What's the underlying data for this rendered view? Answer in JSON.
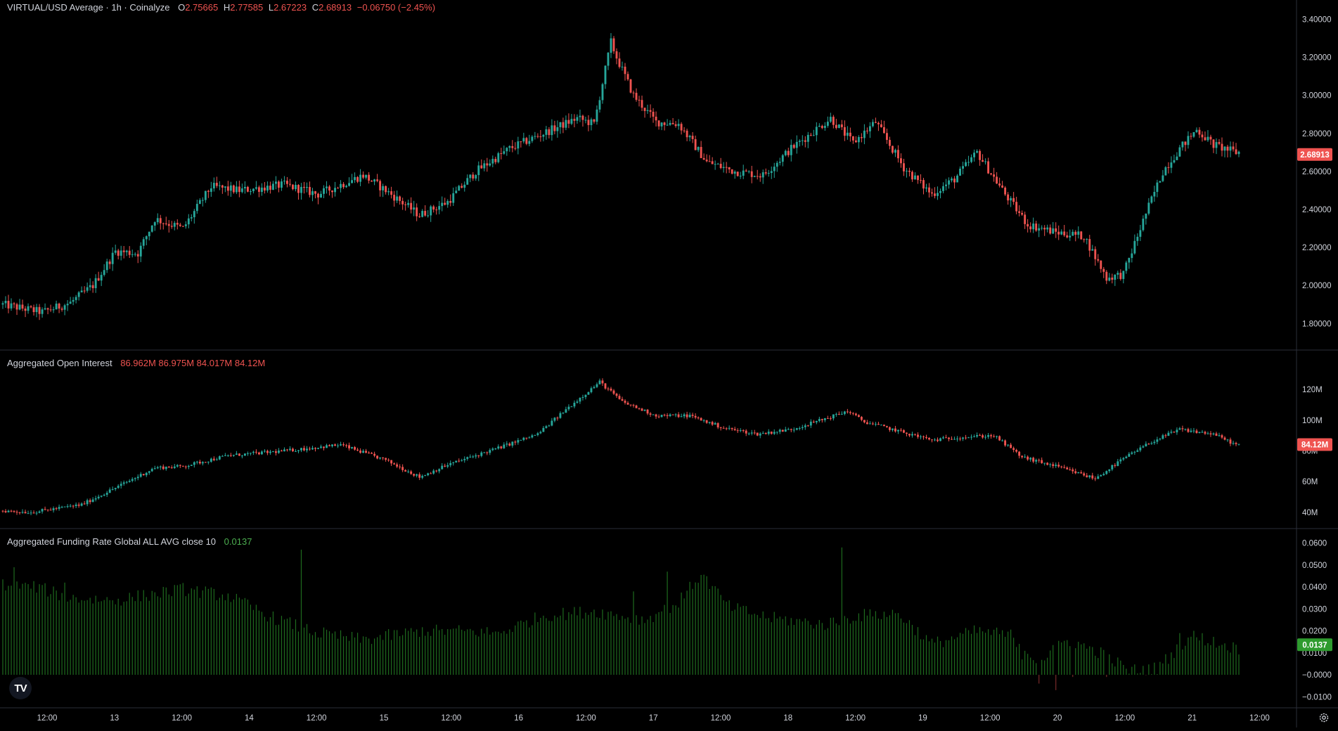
{
  "colors": {
    "up": "#26a69a",
    "down": "#ef5350",
    "funding": "#1e6b1e",
    "funding_bright": "#4caf50",
    "grid": "#2a2e39",
    "text": "#d1d4dc"
  },
  "main_legend": {
    "title": "VIRTUAL/USD Average · 1h · Coinalyze",
    "o_label": "O",
    "o": "2.75665",
    "h_label": "H",
    "h": "2.77585",
    "l_label": "L",
    "l": "2.67223",
    "c_label": "C",
    "c": "2.68913",
    "change": "−0.06750 (−2.45%)"
  },
  "oi_legend": {
    "title": "Aggregated Open Interest",
    "values": "86.962M  86.975M  84.017M  84.12M"
  },
  "fr_legend": {
    "title": "Aggregated Funding Rate Global ALL AVG close 10",
    "value": "0.0137"
  },
  "logo_text": "TV",
  "chart_data": [
    {
      "type": "candlestick",
      "name": "price",
      "ylim": [
        1.72,
        3.42
      ],
      "y_ticks": [
        "3.40000",
        "3.20000",
        "3.00000",
        "2.80000",
        "2.60000",
        "2.40000",
        "2.20000",
        "2.00000",
        "1.80000"
      ],
      "last_value": "2.68913",
      "x_ticks": [
        "12:00",
        "13",
        "12:00",
        "14",
        "12:00",
        "15",
        "12:00",
        "16",
        "12:00",
        "17",
        "12:00",
        "18",
        "12:00",
        "19",
        "12:00",
        "20",
        "12:00",
        "21",
        "12:00"
      ],
      "anchors": [
        [
          0,
          1.9
        ],
        [
          14,
          1.86
        ],
        [
          24,
          1.91
        ],
        [
          32,
          2.0
        ],
        [
          40,
          2.18
        ],
        [
          48,
          2.17
        ],
        [
          54,
          2.35
        ],
        [
          64,
          2.3
        ],
        [
          74,
          2.52
        ],
        [
          84,
          2.5
        ],
        [
          100,
          2.53
        ],
        [
          112,
          2.48
        ],
        [
          128,
          2.58
        ],
        [
          136,
          2.5
        ],
        [
          148,
          2.37
        ],
        [
          158,
          2.44
        ],
        [
          168,
          2.6
        ],
        [
          180,
          2.72
        ],
        [
          192,
          2.8
        ],
        [
          204,
          2.88
        ],
        [
          210,
          2.85
        ],
        [
          216,
          3.28
        ],
        [
          218,
          3.2
        ],
        [
          224,
          3.0
        ],
        [
          232,
          2.86
        ],
        [
          240,
          2.85
        ],
        [
          250,
          2.65
        ],
        [
          260,
          2.6
        ],
        [
          270,
          2.58
        ],
        [
          280,
          2.72
        ],
        [
          294,
          2.88
        ],
        [
          302,
          2.75
        ],
        [
          310,
          2.86
        ],
        [
          320,
          2.62
        ],
        [
          330,
          2.48
        ],
        [
          338,
          2.56
        ],
        [
          346,
          2.7
        ],
        [
          356,
          2.48
        ],
        [
          364,
          2.32
        ],
        [
          374,
          2.28
        ],
        [
          384,
          2.26
        ],
        [
          392,
          2.04
        ],
        [
          398,
          2.06
        ],
        [
          406,
          2.38
        ],
        [
          412,
          2.6
        ],
        [
          418,
          2.72
        ],
        [
          424,
          2.82
        ],
        [
          430,
          2.74
        ],
        [
          438,
          2.7
        ]
      ],
      "n": 440
    },
    {
      "type": "candlestick",
      "name": "open_interest",
      "ylim": [
        34,
        132
      ],
      "y_ticks": [
        "120M",
        "100M",
        "80M",
        "60M",
        "40M"
      ],
      "y_tick_values": [
        120,
        100,
        80,
        60,
        40
      ],
      "last_value": "84.12M",
      "anchors": [
        [
          0,
          41
        ],
        [
          10,
          40
        ],
        [
          28,
          45
        ],
        [
          40,
          56
        ],
        [
          54,
          69
        ],
        [
          64,
          70
        ],
        [
          80,
          77
        ],
        [
          100,
          80
        ],
        [
          120,
          84
        ],
        [
          136,
          74
        ],
        [
          148,
          63
        ],
        [
          158,
          71
        ],
        [
          176,
          82
        ],
        [
          190,
          91
        ],
        [
          200,
          107
        ],
        [
          212,
          125
        ],
        [
          220,
          112
        ],
        [
          232,
          103
        ],
        [
          244,
          103
        ],
        [
          256,
          95
        ],
        [
          268,
          91
        ],
        [
          280,
          94
        ],
        [
          292,
          101
        ],
        [
          300,
          106
        ],
        [
          306,
          99
        ],
        [
          316,
          94
        ],
        [
          330,
          87
        ],
        [
          340,
          89
        ],
        [
          352,
          90
        ],
        [
          362,
          76
        ],
        [
          374,
          70
        ],
        [
          388,
          62
        ],
        [
          398,
          75
        ],
        [
          408,
          86
        ],
        [
          418,
          94
        ],
        [
          430,
          91
        ],
        [
          438,
          84
        ]
      ],
      "n": 440
    },
    {
      "type": "bar",
      "name": "funding_rate",
      "ylim": [
        -0.0128,
        0.0615
      ],
      "y_ticks": [
        "0.0600",
        "0.0500",
        "0.0400",
        "0.0300",
        "0.0200",
        "0.0100",
        "−0.0000",
        "−0.0100"
      ],
      "y_tick_values": [
        0.06,
        0.05,
        0.04,
        0.03,
        0.02,
        0.01,
        0,
        -0.01
      ],
      "last_value": "0.0137",
      "anchors": [
        [
          0,
          0.041
        ],
        [
          12,
          0.04
        ],
        [
          24,
          0.035
        ],
        [
          40,
          0.034
        ],
        [
          64,
          0.039
        ],
        [
          80,
          0.036
        ],
        [
          96,
          0.026
        ],
        [
          112,
          0.019
        ],
        [
          128,
          0.016
        ],
        [
          148,
          0.02
        ],
        [
          164,
          0.02
        ],
        [
          176,
          0.019
        ],
        [
          192,
          0.027
        ],
        [
          210,
          0.029
        ],
        [
          228,
          0.025
        ],
        [
          240,
          0.033
        ],
        [
          248,
          0.046
        ],
        [
          258,
          0.031
        ],
        [
          272,
          0.026
        ],
        [
          292,
          0.023
        ],
        [
          304,
          0.027
        ],
        [
          318,
          0.028
        ],
        [
          330,
          0.014
        ],
        [
          346,
          0.02
        ],
        [
          358,
          0.018
        ],
        [
          368,
          0.006
        ],
        [
          378,
          0.016
        ],
        [
          390,
          0.01
        ],
        [
          400,
          0.002
        ],
        [
          410,
          0.003
        ],
        [
          422,
          0.018
        ],
        [
          438,
          0.012
        ]
      ],
      "spikes": [
        [
          4,
          0.049
        ],
        [
          22,
          0.042
        ],
        [
          106,
          0.057
        ],
        [
          224,
          0.038
        ],
        [
          236,
          0.047
        ],
        [
          298,
          0.058
        ],
        [
          310,
          0.029
        ],
        [
          362,
          0.007
        ],
        [
          368,
          -0.004
        ],
        [
          374,
          -0.007
        ],
        [
          380,
          -0.001
        ],
        [
          392,
          -0.001
        ],
        [
          418,
          0.019
        ],
        [
          438,
          0.0137
        ]
      ],
      "n": 440
    }
  ]
}
